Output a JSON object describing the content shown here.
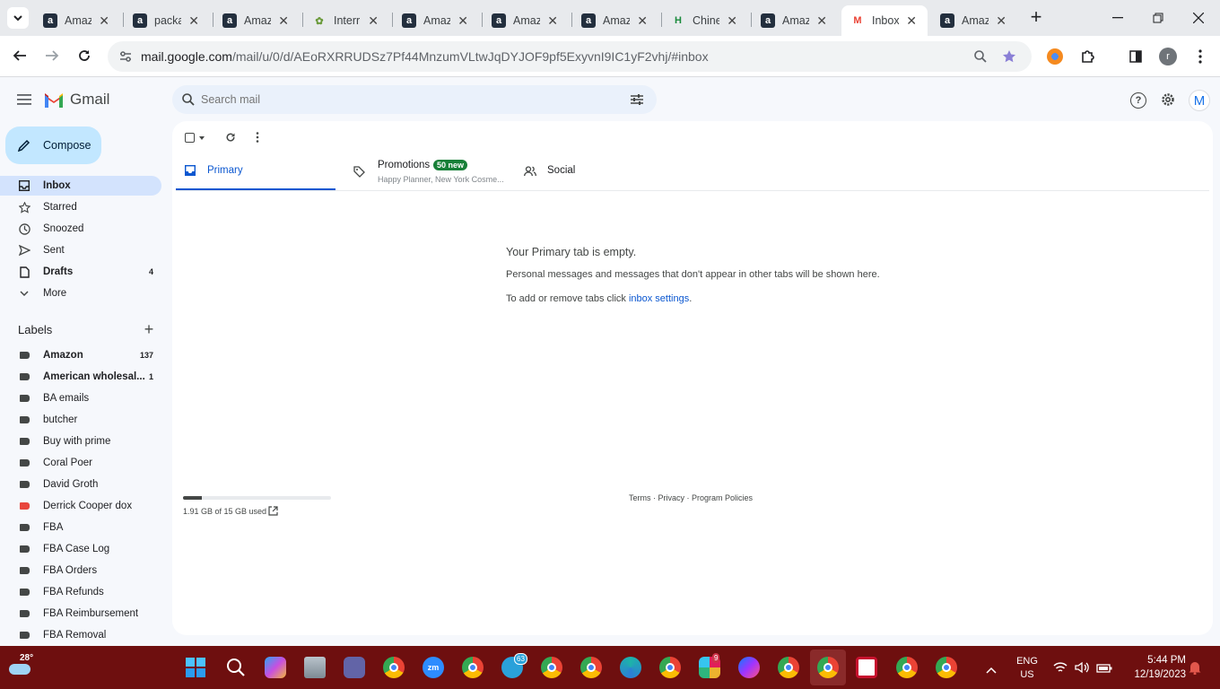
{
  "browser": {
    "tabs": [
      {
        "title": "Amaz",
        "fav": "a"
      },
      {
        "title": "packa",
        "fav": "a"
      },
      {
        "title": "Amaz",
        "fav": "a"
      },
      {
        "title": "Interr",
        "fav": "leaf"
      },
      {
        "title": "Amaz",
        "fav": "a"
      },
      {
        "title": "Amaz",
        "fav": "a"
      },
      {
        "title": "Amaz",
        "fav": "a"
      },
      {
        "title": "Chine",
        "fav": "h"
      },
      {
        "title": "Amaz",
        "fav": "a"
      },
      {
        "title": "Inbox",
        "fav": "gmail"
      },
      {
        "title": "Amaz",
        "fav": "a"
      }
    ],
    "url_host": "mail.google.com",
    "url_path": "/mail/u/0/d/AEoRXRRUDSz7Pf44MnzumVLtwJqDYJOF9pf5ExyvnI9IC1yF2vhj/#inbox",
    "profile_initial": "r"
  },
  "gmail": {
    "logo": "Gmail",
    "search_placeholder": "Search mail",
    "avatar": "M",
    "compose": "Compose",
    "nav": [
      {
        "label": "Inbox",
        "count": "",
        "icon": "inbox-icon"
      },
      {
        "label": "Starred",
        "count": "",
        "icon": "star-icon"
      },
      {
        "label": "Snoozed",
        "count": "",
        "icon": "clock-icon"
      },
      {
        "label": "Sent",
        "count": "",
        "icon": "send-icon"
      },
      {
        "label": "Drafts",
        "count": "4",
        "icon": "draft-icon"
      },
      {
        "label": "More",
        "count": "",
        "icon": "chevron-down-icon"
      }
    ],
    "labels_heading": "Labels",
    "labels": [
      {
        "label": "Amazon",
        "count": "137",
        "bold": true,
        "color": "#444746"
      },
      {
        "label": "American wholesal...",
        "count": "1",
        "bold": true,
        "color": "#444746"
      },
      {
        "label": "BA emails",
        "count": "",
        "bold": false,
        "color": "#444746"
      },
      {
        "label": "butcher",
        "count": "",
        "bold": false,
        "color": "#444746"
      },
      {
        "label": "Buy with prime",
        "count": "",
        "bold": false,
        "color": "#444746"
      },
      {
        "label": "Coral Poer",
        "count": "",
        "bold": false,
        "color": "#444746"
      },
      {
        "label": "David Groth",
        "count": "",
        "bold": false,
        "color": "#444746"
      },
      {
        "label": "Derrick Cooper dox",
        "count": "",
        "bold": false,
        "color": "#e8453c"
      },
      {
        "label": "FBA",
        "count": "",
        "bold": false,
        "color": "#444746"
      },
      {
        "label": "FBA Case Log",
        "count": "",
        "bold": false,
        "color": "#444746"
      },
      {
        "label": "FBA Orders",
        "count": "",
        "bold": false,
        "color": "#444746"
      },
      {
        "label": "FBA Refunds",
        "count": "",
        "bold": false,
        "color": "#444746"
      },
      {
        "label": "FBA Reimbursement",
        "count": "",
        "bold": false,
        "color": "#444746"
      },
      {
        "label": "FBA Removal",
        "count": "",
        "bold": false,
        "color": "#444746"
      }
    ],
    "tabs": {
      "primary": "Primary",
      "promotions": "Promotions",
      "promotions_badge": "50 new",
      "promotions_snippet": "Happy Planner, New York Cosme...",
      "social": "Social"
    },
    "empty": {
      "title": "Your Primary tab is empty.",
      "desc": "Personal messages and messages that don't appear in other tabs will be shown here.",
      "settings_prefix": "To add or remove tabs click ",
      "settings_link": "inbox settings",
      "settings_suffix": "."
    },
    "storage": {
      "text": "1.91 GB of 15 GB used",
      "fraction": 0.127
    },
    "footer": "Terms · Privacy · Program Policies"
  },
  "taskbar": {
    "weather_temp": "28°",
    "lang1": "ENG",
    "lang2": "US",
    "time": "5:44 PM",
    "date": "12/19/2023",
    "badges": {
      "telegram": "63",
      "slack": "9"
    }
  }
}
